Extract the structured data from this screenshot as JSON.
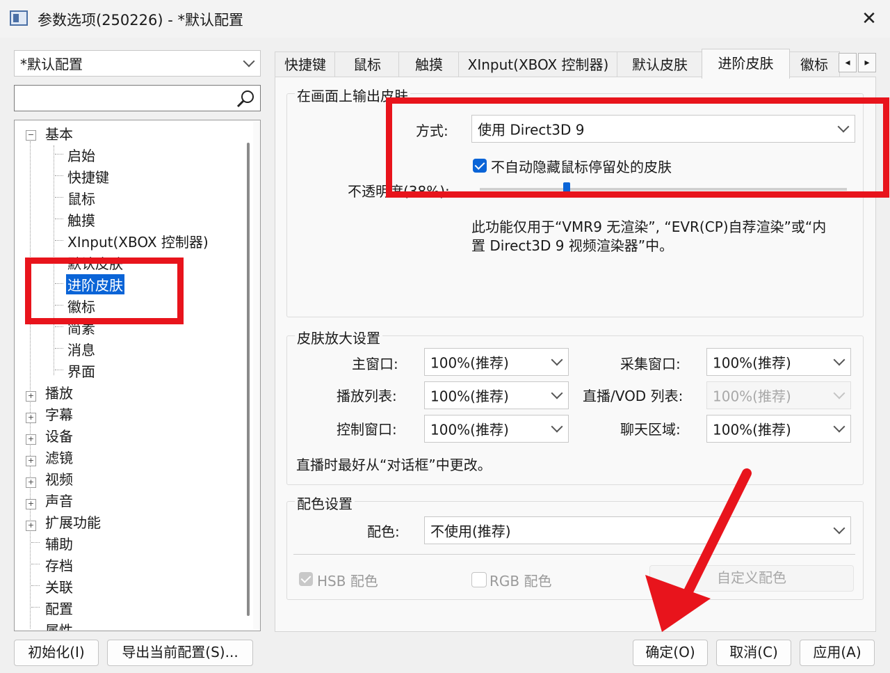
{
  "window": {
    "title": "参数选项(250226) - *默认配置",
    "close_glyph": "✕"
  },
  "profile_select": {
    "value": "*默认配置"
  },
  "search": {
    "value": "",
    "icon": "search-icon"
  },
  "tree": {
    "items": [
      {
        "label": "基本",
        "expander": "⊟"
      },
      {
        "label": "启始"
      },
      {
        "label": "快捷键"
      },
      {
        "label": "鼠标"
      },
      {
        "label": "触摸"
      },
      {
        "label": "XInput(XBOX 控制器)"
      },
      {
        "label": "默认皮肤"
      },
      {
        "label": "进阶皮肤"
      },
      {
        "label": "徽标"
      },
      {
        "label": "简素"
      },
      {
        "label": "消息"
      },
      {
        "label": "界面"
      },
      {
        "label": "播放",
        "expander": "⊞"
      },
      {
        "label": "字幕",
        "expander": "⊞"
      },
      {
        "label": "设备",
        "expander": "⊞"
      },
      {
        "label": "滤镜",
        "expander": "⊞"
      },
      {
        "label": "视频",
        "expander": "⊞"
      },
      {
        "label": "声音",
        "expander": "⊞"
      },
      {
        "label": "扩展功能",
        "expander": "⊞"
      },
      {
        "label": "辅助"
      },
      {
        "label": "存档"
      },
      {
        "label": "关联"
      },
      {
        "label": "配置"
      },
      {
        "label": "属性"
      }
    ]
  },
  "tabs": [
    "快捷键",
    "鼠标",
    "触摸",
    "XInput(XBOX 控制器)",
    "默认皮肤",
    "进阶皮肤",
    "徽标"
  ],
  "tab_scroll": {
    "left": "◂",
    "right": "▸"
  },
  "output": {
    "legend": "在画面上输出皮肤",
    "method_label": "方式:",
    "method_value": "使用 Direct3D 9",
    "checkbox_label": "不自动隐藏鼠标停留处的皮肤",
    "checkbox_checked": true,
    "opacity_label": "不透明度(38%):",
    "opacity_fraction": 0.38,
    "note_line1": "此功能仅用于“VMR9 无渲染”, “EVR(CP)自荐渲染”或“内",
    "note_line2": "置 Direct3D 9 视频渲染器”中。"
  },
  "zoom": {
    "legend": "皮肤放大设置",
    "main_label": "主窗口:",
    "main_value": "100%(推荐)",
    "capture_label": "采集窗口:",
    "capture_value": "100%(推荐)",
    "playlist_label": "播放列表:",
    "playlist_value": "100%(推荐)",
    "live_label": "直播/VOD 列表:",
    "live_value": "100%(推荐)",
    "control_label": "控制窗口:",
    "control_value": "100%(推荐)",
    "chat_label": "聊天区域:",
    "chat_value": "100%(推荐)",
    "note": "直播时最好从“对话框”中更改。"
  },
  "color": {
    "legend": "配色设置",
    "label": "配色:",
    "value": "不使用(推荐)",
    "hsb_label": "HSB 配色",
    "rgb_label": "RGB 配色",
    "custom_button": "自定义配色"
  },
  "footer": {
    "init_button": "初始化(I)",
    "export_button": "导出当前配置(S)...",
    "ok_button": "确定(O)",
    "cancel_button": "取消(C)",
    "apply_button": "应用(A)"
  },
  "annotation_color": "#e8141c",
  "accent_color": "#0a64d7"
}
